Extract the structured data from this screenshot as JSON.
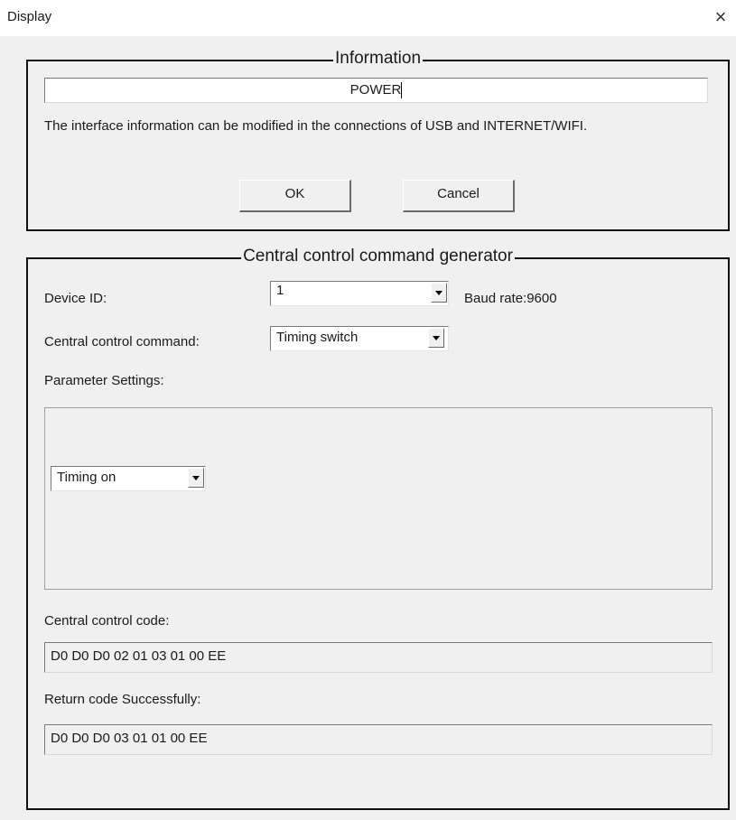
{
  "window": {
    "title": "Display",
    "close_glyph": "×"
  },
  "information": {
    "title": "Information",
    "name_value": "POWER",
    "description": "The interface information can be modified in the connections of USB and INTERNET/WIFI.",
    "ok_label": "OK",
    "cancel_label": "Cancel"
  },
  "generator": {
    "title": "Central control command generator",
    "device_id_label": "Device ID:",
    "device_id_value": "1",
    "baud_rate": "Baud rate:9600",
    "command_label": "Central control command:",
    "command_value": "Timing switch",
    "parameter_label": "Parameter Settings:",
    "parameter_value": "Timing on",
    "code_label": "Central control code:",
    "code_value": "D0 D0 D0 02 01 03 01 00 EE",
    "return_label": "Return code Successfully:",
    "return_value": "D0 D0 D0 03 01 01 00 EE"
  }
}
